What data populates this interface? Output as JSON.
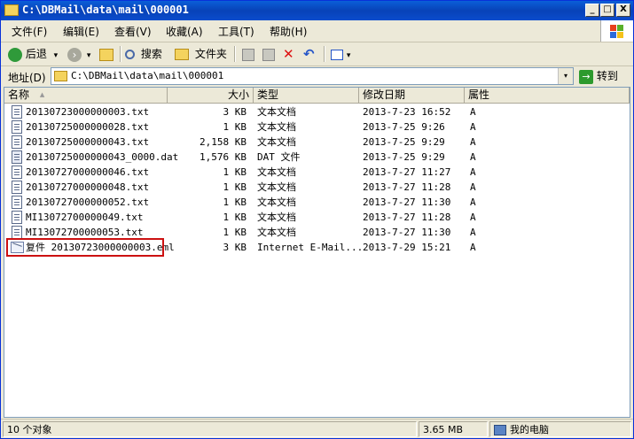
{
  "window": {
    "title": "C:\\DBMail\\data\\mail\\000001",
    "controls": {
      "minimize": "_",
      "maximize": "□",
      "close": "X"
    }
  },
  "menu": [
    "文件(F)",
    "编辑(E)",
    "查看(V)",
    "收藏(A)",
    "工具(T)",
    "帮助(H)"
  ],
  "toolbar": {
    "back": "后退",
    "search": "搜索",
    "folders": "文件夹",
    "forward_arrow": "›",
    "dropdown": "▾"
  },
  "address": {
    "label": "地址(D)",
    "value": "C:\\DBMail\\data\\mail\\000001",
    "go": "转到",
    "go_arrow": "→",
    "dropdown": "▾"
  },
  "columns": {
    "name": "名称",
    "size": "大小",
    "type": "类型",
    "modified": "修改日期",
    "attr": "属性",
    "sort_indicator": "▲"
  },
  "files": [
    {
      "name": "20130723000000003.txt",
      "size": "3 KB",
      "type": "文本文档",
      "modified": "2013-7-23 16:52",
      "attr": "A",
      "icon": "text-file-icon"
    },
    {
      "name": "20130725000000028.txt",
      "size": "1 KB",
      "type": "文本文档",
      "modified": "2013-7-25 9:26",
      "attr": "A",
      "icon": "text-file-icon"
    },
    {
      "name": "20130725000000043.txt",
      "size": "2,158 KB",
      "type": "文本文档",
      "modified": "2013-7-25 9:29",
      "attr": "A",
      "icon": "text-file-icon"
    },
    {
      "name": "20130725000000043_0000.dat",
      "size": "1,576 KB",
      "type": "DAT 文件",
      "modified": "2013-7-25 9:29",
      "attr": "A",
      "icon": "dat-file-icon"
    },
    {
      "name": "20130727000000046.txt",
      "size": "1 KB",
      "type": "文本文档",
      "modified": "2013-7-27 11:27",
      "attr": "A",
      "icon": "text-file-icon"
    },
    {
      "name": "20130727000000048.txt",
      "size": "1 KB",
      "type": "文本文档",
      "modified": "2013-7-27 11:28",
      "attr": "A",
      "icon": "text-file-icon"
    },
    {
      "name": "20130727000000052.txt",
      "size": "1 KB",
      "type": "文本文档",
      "modified": "2013-7-27 11:30",
      "attr": "A",
      "icon": "text-file-icon"
    },
    {
      "name": "MI13072700000049.txt",
      "size": "1 KB",
      "type": "文本文档",
      "modified": "2013-7-27 11:28",
      "attr": "A",
      "icon": "text-file-icon"
    },
    {
      "name": "MI13072700000053.txt",
      "size": "1 KB",
      "type": "文本文档",
      "modified": "2013-7-27 11:30",
      "attr": "A",
      "icon": "text-file-icon"
    },
    {
      "name": "复件 20130723000000003.eml",
      "size": "3 KB",
      "type": "Internet E-Mail...",
      "modified": "2013-7-29 15:21",
      "attr": "A",
      "icon": "email-file-icon",
      "highlighted": true
    }
  ],
  "status": {
    "count": "10 个对象",
    "size": "3.65 MB",
    "location": "我的电脑"
  }
}
